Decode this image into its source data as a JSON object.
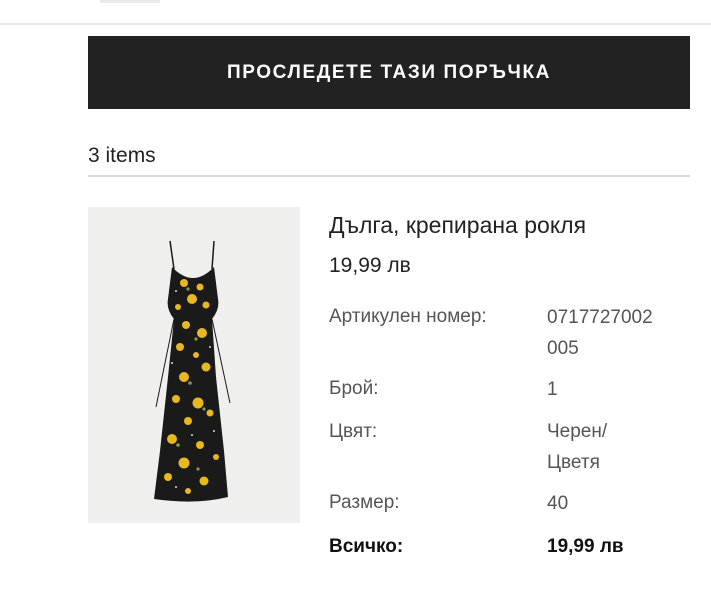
{
  "order": {
    "track_button_label": "ПРОСЛЕДЕТЕ ТАЗИ ПОРЪЧКА",
    "items_count_text": "3 items"
  },
  "product": {
    "name": "Дълга, крепирана рокля",
    "price": "19,99 лв",
    "details": {
      "article_label": "Артикулен номер:",
      "article_value_line1": "0717727002",
      "article_value_line2": "005",
      "quantity_label": "Брой:",
      "quantity_value": "1",
      "color_label": "Цвят:",
      "color_value_line1": "Черен/",
      "color_value_line2": "Цветя",
      "size_label": "Размер:",
      "size_value": "40"
    },
    "total_label": "Всичко:",
    "total_value": "19,99 лв"
  },
  "colors": {
    "button_background": "#222222",
    "button_text": "#ffffff",
    "text_primary": "#222222",
    "text_secondary": "#555555",
    "image_background": "#efefed",
    "dress_fabric": "#1a1a1a",
    "dress_flowers": "#e8b820"
  }
}
